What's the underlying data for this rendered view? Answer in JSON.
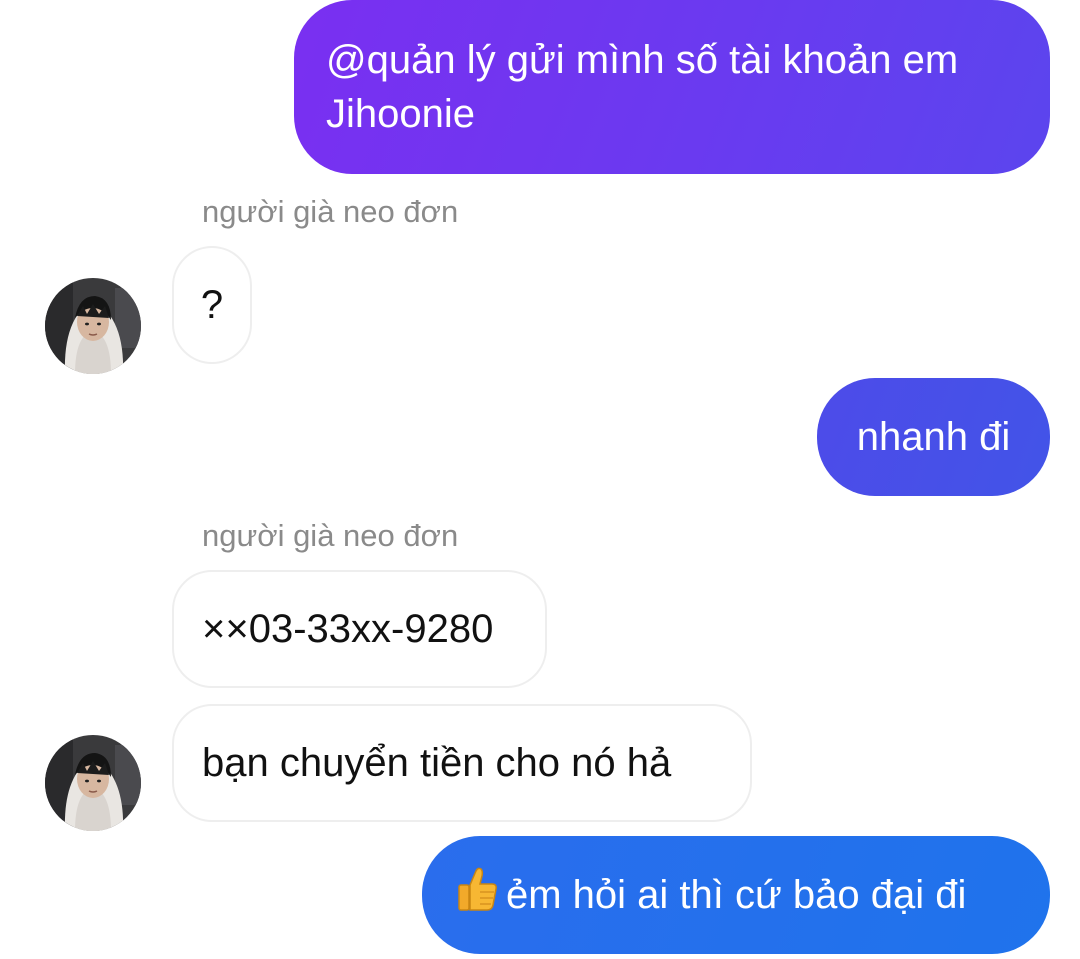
{
  "conversation": {
    "messages": [
      {
        "direction": "outgoing",
        "text": "@quản lý gửi mình số tài khoản em Jihoonie"
      },
      {
        "direction": "incoming",
        "sender": "người già neo đơn",
        "text": "?"
      },
      {
        "direction": "outgoing",
        "text": "nhanh đi"
      },
      {
        "direction": "incoming",
        "sender": "người già neo đơn",
        "text": "××03-33xx-9280"
      },
      {
        "direction": "incoming",
        "text": "bạn chuyển tiền cho nó hả"
      },
      {
        "direction": "outgoing",
        "emoji": "thumbs-up-icon",
        "text": "ẻm hỏi ai thì cứ bảo đại đi"
      }
    ]
  },
  "colors": {
    "outgoing_top": "#7433f0",
    "outgoing_mid": "#4356ea",
    "outgoing_bottom": "#1f73ec",
    "incoming_border": "#eeeeee",
    "sender_name": "#8a8a8a"
  }
}
